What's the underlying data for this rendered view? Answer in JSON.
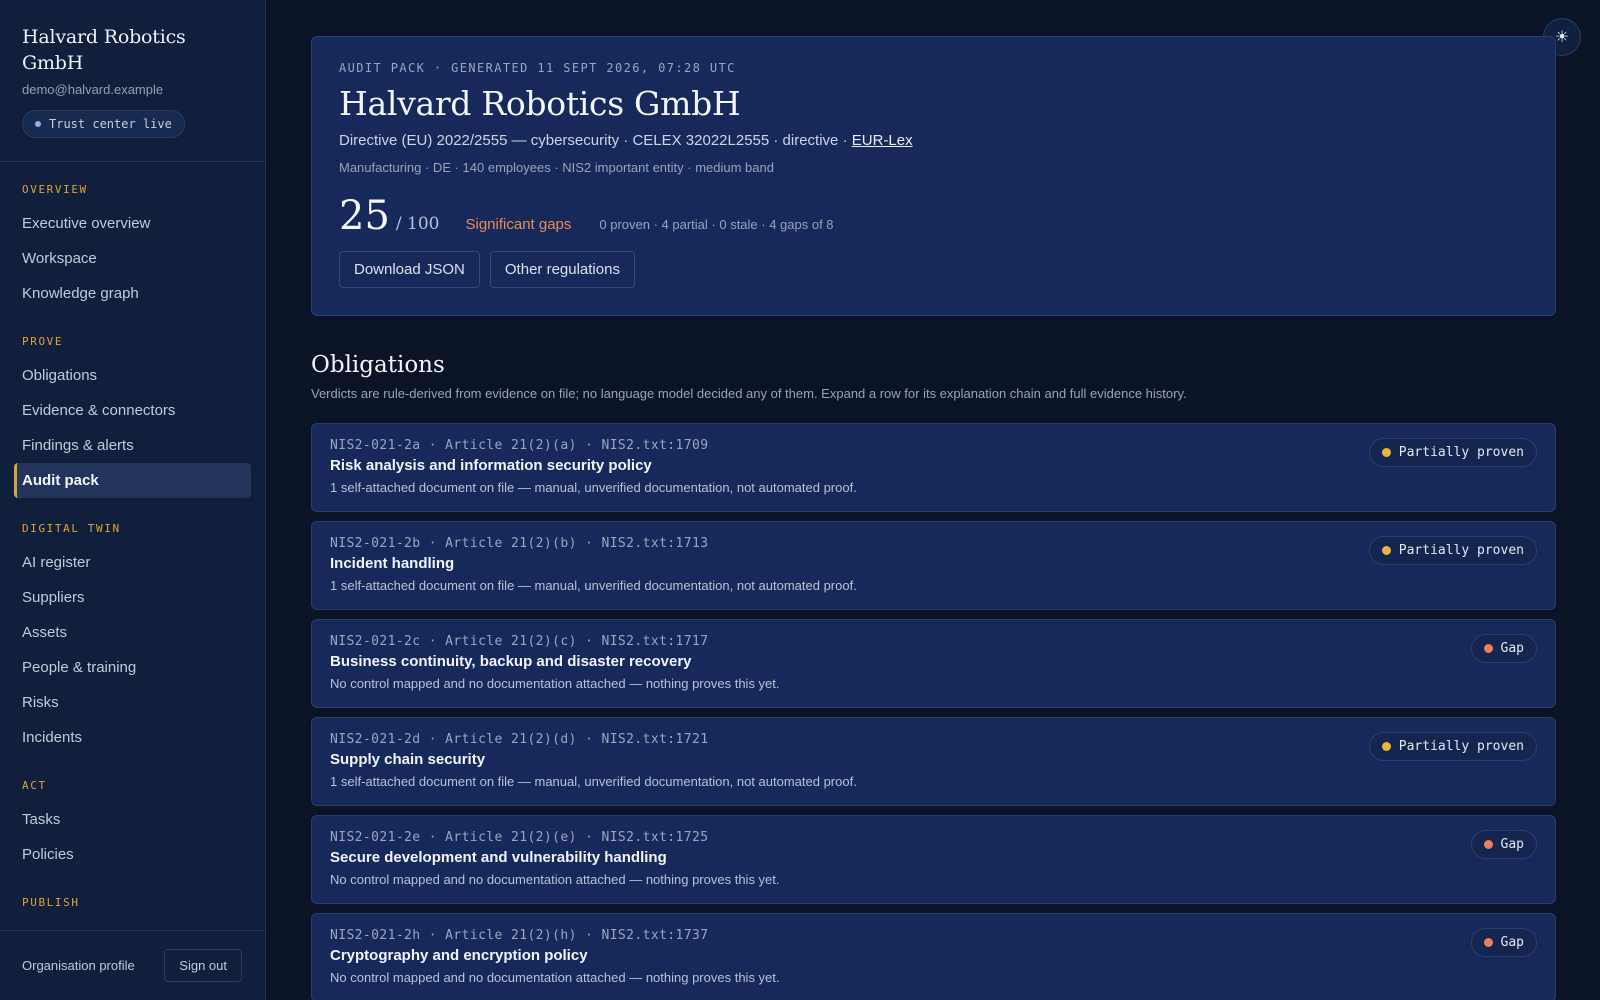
{
  "org": {
    "name": "Halvard Robotics GmbH",
    "email": "demo@halvard.example",
    "trust_status": "Trust center live"
  },
  "nav": {
    "sections": [
      {
        "label": "OVERVIEW",
        "items": [
          "Executive overview",
          "Workspace",
          "Knowledge graph"
        ]
      },
      {
        "label": "PROVE",
        "items": [
          "Obligations",
          "Evidence & connectors",
          "Findings & alerts",
          "Audit pack"
        ]
      },
      {
        "label": "DIGITAL TWIN",
        "items": [
          "AI register",
          "Suppliers",
          "Assets",
          "People & training",
          "Risks",
          "Incidents"
        ]
      },
      {
        "label": "ACT",
        "items": [
          "Tasks",
          "Policies"
        ]
      },
      {
        "label": "PUBLISH",
        "items": []
      }
    ],
    "active_item": "Audit pack"
  },
  "footer": {
    "org_profile": "Organisation profile",
    "sign_out": "Sign out"
  },
  "theme_toggle_icon": "sun-icon",
  "hero": {
    "meta": "AUDIT PACK · GENERATED 11 SEPT 2026, 07:28 UTC",
    "title": "Halvard Robotics GmbH",
    "directive": "Directive (EU) 2022/2555 — cybersecurity · CELEX 32022L2555 · directive · ",
    "eurlex_link": "EUR-Lex",
    "profile": "Manufacturing · DE · 140 employees · NIS2 important entity · medium band",
    "score": "25",
    "score_max": "/ 100",
    "score_status": "Significant gaps",
    "counts": "0 proven · 4 partial · 0 stale · 4 gaps of 8",
    "actions": {
      "download": "Download JSON",
      "other": "Other regulations"
    }
  },
  "obligations": {
    "title": "Obligations",
    "subtitle": "Verdicts are rule-derived from evidence on file; no language model decided any of them. Expand a row for its explanation chain and full evidence history.",
    "rows": [
      {
        "meta": "NIS2-021-2a · Article 21(2)(a) · NIS2.txt:1709",
        "title": "Risk analysis and information security policy",
        "desc": "1 self-attached document on file — manual, unverified documentation, not automated proof.",
        "status": "Partially proven",
        "color": "#f0b13e"
      },
      {
        "meta": "NIS2-021-2b · Article 21(2)(b) · NIS2.txt:1713",
        "title": "Incident handling",
        "desc": "1 self-attached document on file — manual, unverified documentation, not automated proof.",
        "status": "Partially proven",
        "color": "#f0b13e"
      },
      {
        "meta": "NIS2-021-2c · Article 21(2)(c) · NIS2.txt:1717",
        "title": "Business continuity, backup and disaster recovery",
        "desc": "No control mapped and no documentation attached — nothing proves this yet.",
        "status": "Gap",
        "color": "#ee7f58"
      },
      {
        "meta": "NIS2-021-2d · Article 21(2)(d) · NIS2.txt:1721",
        "title": "Supply chain security",
        "desc": "1 self-attached document on file — manual, unverified documentation, not automated proof.",
        "status": "Partially proven",
        "color": "#f0b13e"
      },
      {
        "meta": "NIS2-021-2e · Article 21(2)(e) · NIS2.txt:1725",
        "title": "Secure development and vulnerability handling",
        "desc": "No control mapped and no documentation attached — nothing proves this yet.",
        "status": "Gap",
        "color": "#ee7f58"
      },
      {
        "meta": "NIS2-021-2h · Article 21(2)(h) · NIS2.txt:1737",
        "title": "Cryptography and encryption policy",
        "desc": "No control mapped and no documentation attached — nothing proves this yet.",
        "status": "Gap",
        "color": "#ee7f58"
      }
    ]
  }
}
